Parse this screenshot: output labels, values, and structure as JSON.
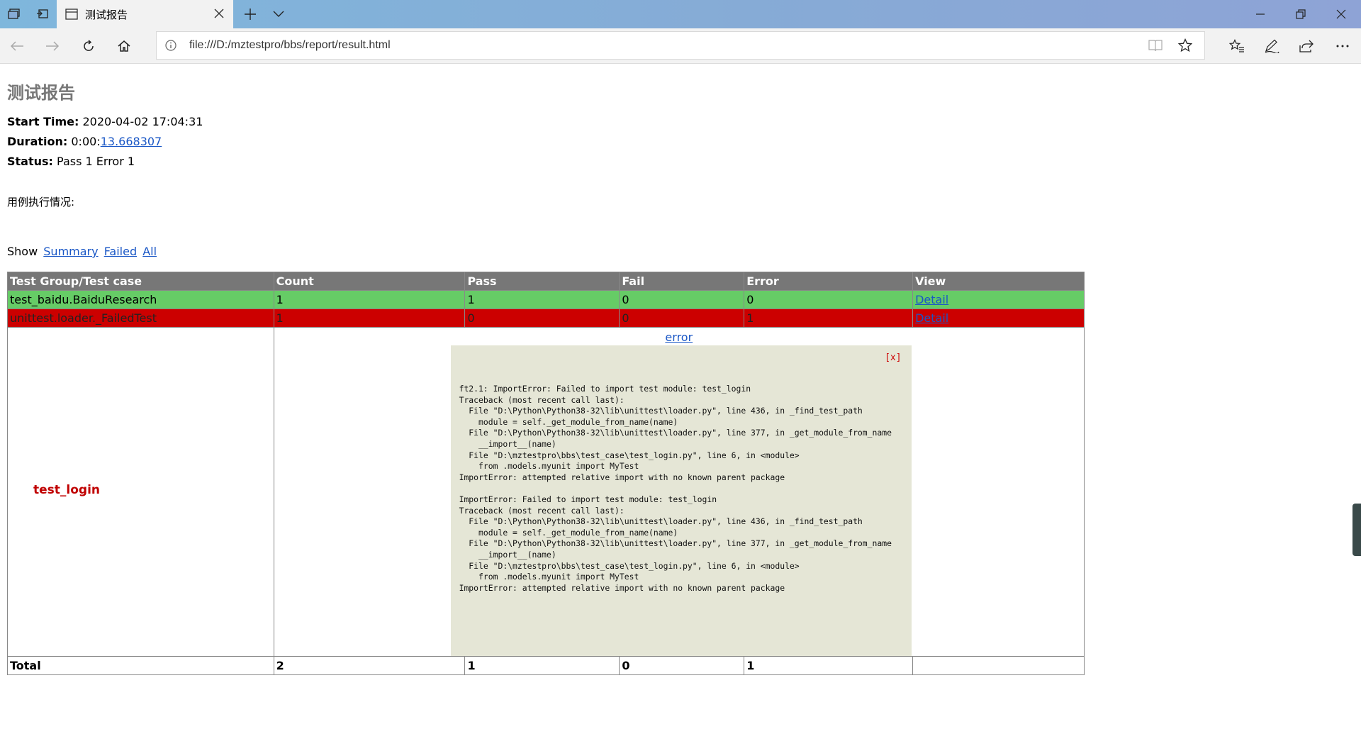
{
  "browser": {
    "tab_title": "测试报告",
    "url": "file:///D:/mztestpro/bbs/report/result.html"
  },
  "report": {
    "title": "测试报告",
    "start_time_label": "Start Time:",
    "start_time_value": "2020-04-02 17:04:31",
    "duration_label": "Duration:",
    "duration_prefix": "0:00:",
    "duration_link": "13.668307",
    "status_label": "Status:",
    "status_value": "Pass 1 Error 1",
    "exec_label": "用例执行情况:",
    "show_label": "Show",
    "show_links": [
      "Summary",
      "Failed",
      "All"
    ]
  },
  "table": {
    "headers": [
      "Test Group/Test case",
      "Count",
      "Pass",
      "Fail",
      "Error",
      "View"
    ],
    "rows": [
      {
        "name": "test_baidu.BaiduResearch",
        "count": "1",
        "pass": "1",
        "fail": "0",
        "error": "0",
        "view": "Detail"
      },
      {
        "name": "unittest.loader._FailedTest",
        "count": "1",
        "pass": "0",
        "fail": "0",
        "error": "1",
        "view": "Detail"
      }
    ],
    "detail": {
      "case_name": "test_login",
      "link": "error",
      "close": "[x]",
      "traceback": "ft2.1: ImportError: Failed to import test module: test_login\nTraceback (most recent call last):\n  File \"D:\\Python\\Python38-32\\lib\\unittest\\loader.py\", line 436, in _find_test_path\n    module = self._get_module_from_name(name)\n  File \"D:\\Python\\Python38-32\\lib\\unittest\\loader.py\", line 377, in _get_module_from_name\n    __import__(name)\n  File \"D:\\mztestpro\\bbs\\test_case\\test_login.py\", line 6, in <module>\n    from .models.myunit import MyTest\nImportError: attempted relative import with no known parent package\n\nImportError: Failed to import test module: test_login\nTraceback (most recent call last):\n  File \"D:\\Python\\Python38-32\\lib\\unittest\\loader.py\", line 436, in _find_test_path\n    module = self._get_module_from_name(name)\n  File \"D:\\Python\\Python38-32\\lib\\unittest\\loader.py\", line 377, in _get_module_from_name\n    __import__(name)\n  File \"D:\\mztestpro\\bbs\\test_case\\test_login.py\", line 6, in <module>\n    from .models.myunit import MyTest\nImportError: attempted relative import with no known parent package"
    },
    "total": {
      "label": "Total",
      "count": "2",
      "pass": "1",
      "fail": "0",
      "error": "1",
      "view": ""
    }
  },
  "colors": {
    "header_bg": "#777777",
    "pass_bg": "#66cc66",
    "error_bg": "#cc0000",
    "popup_bg": "#e5e6d6",
    "link": "#1a57c6"
  }
}
